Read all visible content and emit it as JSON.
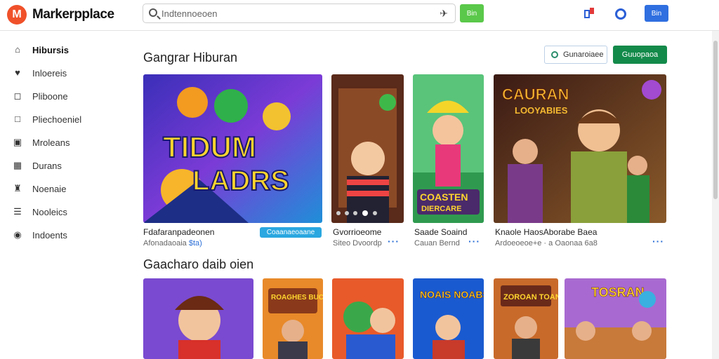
{
  "app": {
    "logo_letter": "M",
    "brand": "Markerpplace"
  },
  "search": {
    "placeholder": "Indtennoeoen",
    "value": "Indtennoeoen"
  },
  "header": {
    "go_label": "Bin",
    "user_label": "Bin",
    "cart_icon": "cart-icon",
    "notification_icon": "notification-icon"
  },
  "sidebar": {
    "items": [
      {
        "label": "Hibursis",
        "icon": "home-icon",
        "active": true
      },
      {
        "label": "Inloereis",
        "icon": "heart-icon"
      },
      {
        "label": "Pliboone",
        "icon": "box-icon"
      },
      {
        "label": "Pliechoeniel",
        "icon": "square-icon"
      },
      {
        "label": "Mroleans",
        "icon": "image-icon"
      },
      {
        "label": "Durans",
        "icon": "tag-icon"
      },
      {
        "label": "Noenaie",
        "icon": "building-icon"
      },
      {
        "label": "Nooleics",
        "icon": "list-icon"
      },
      {
        "label": "Indoents",
        "icon": "circle-square-icon"
      }
    ]
  },
  "section1": {
    "title": "Gangrar Hiburan",
    "location_button": "Gunaroiaee",
    "primary_button": "Guuopaoa",
    "cards": [
      {
        "title": "Fdafaranpadeonen",
        "subtitle": "Afonadaoaia",
        "subtitle_highlight": "$ta)",
        "badge": "Coaanaeoaane",
        "thumb_text_1": "TIDUM",
        "thumb_text_2": "LADRS"
      },
      {
        "title": "Gvorrioeome",
        "subtitle": "Siteo Dvoordp"
      },
      {
        "title": "Saade Soaind",
        "subtitle": "Cauan Bernd",
        "thumb_text_1": "COASTEN",
        "thumb_text_2": "DIERCARE"
      },
      {
        "title": "Knaole HaosAborabe Baea",
        "subtitle": "Ardoeoeoe+e · a Oaonaa 6a8",
        "thumb_text_1": "CAURAN",
        "thumb_text_2": "LOOYABIES"
      }
    ]
  },
  "section2": {
    "title": "Gaacharo daib oien",
    "thumb_texts": [
      "ROAGHES BUCKERS",
      "NOAIS NOABS",
      "ZOROAN TOAN",
      "TOSRAN"
    ]
  },
  "colors": {
    "accent_green": "#138a4a",
    "accent_blue": "#2f6fe0",
    "logo_orange": "#f0512a"
  }
}
